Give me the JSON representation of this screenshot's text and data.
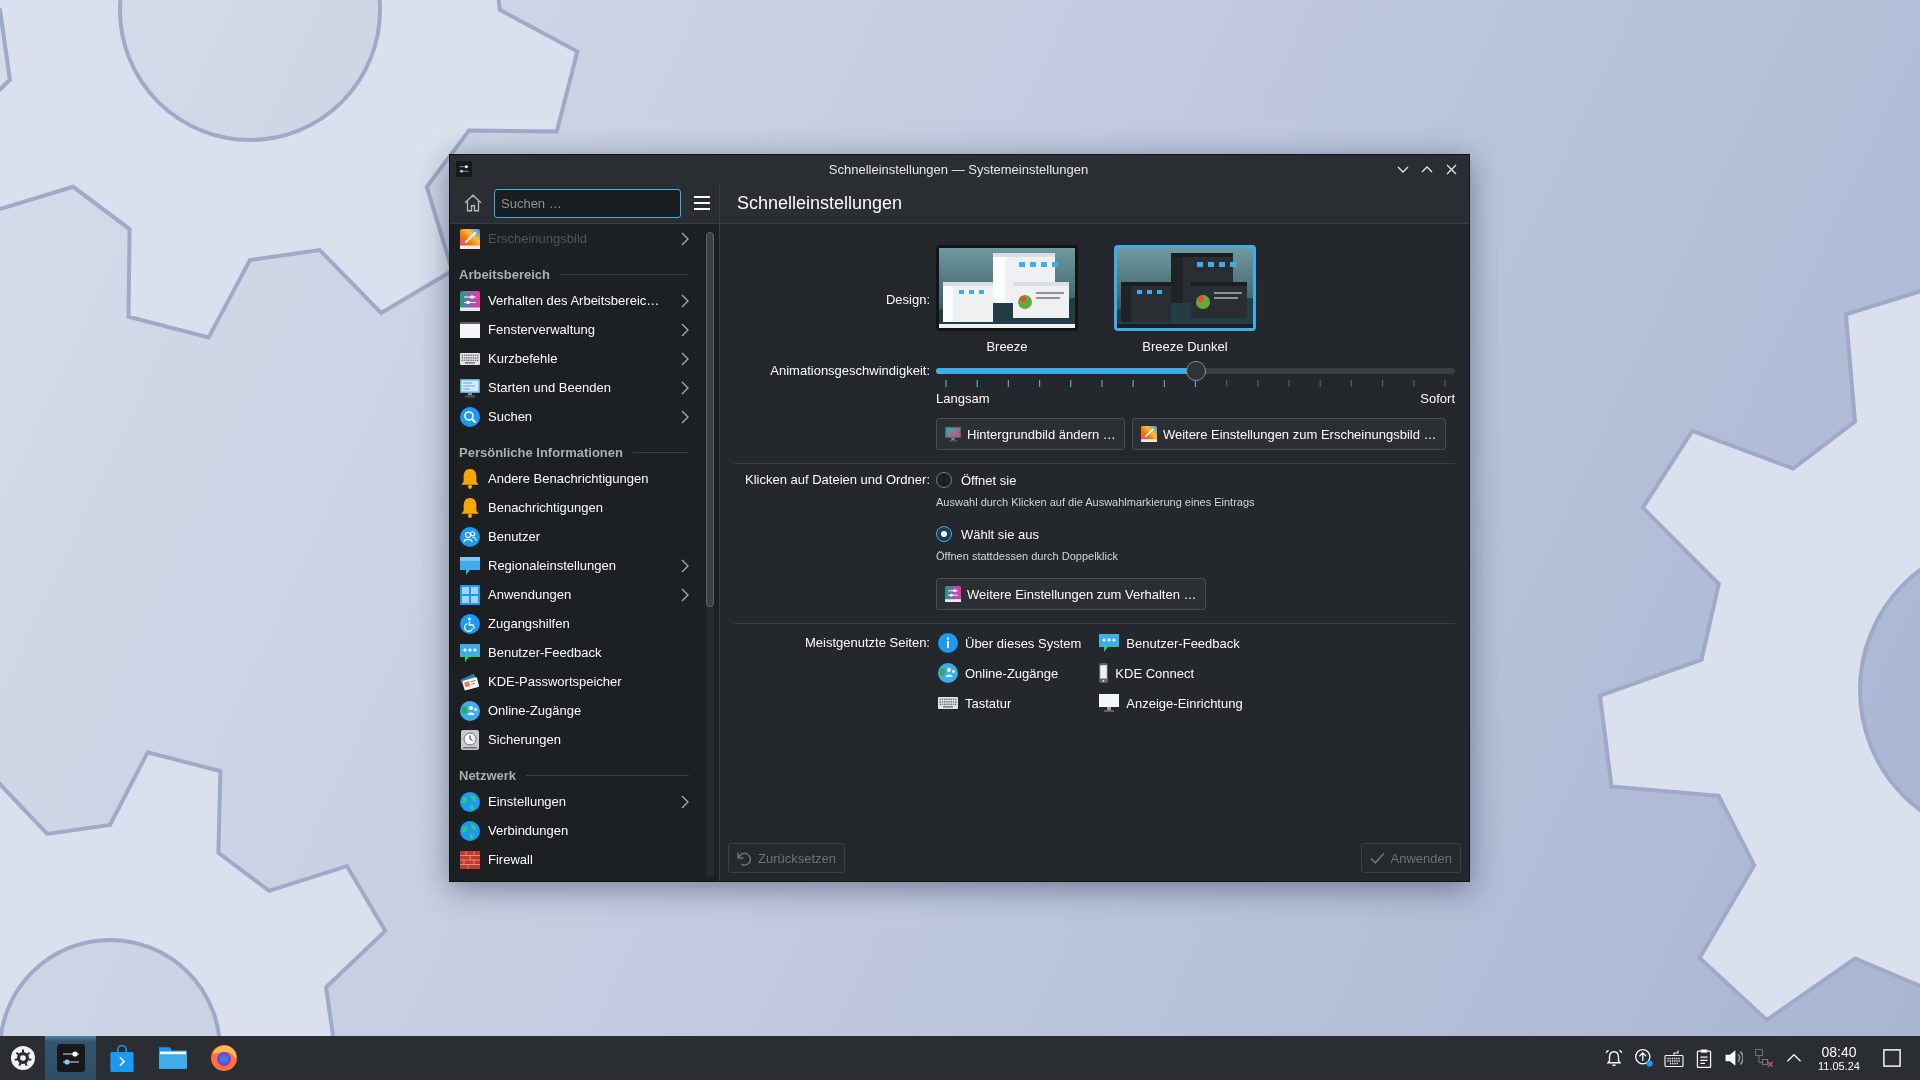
{
  "window": {
    "title": "Schnelleinstellungen — Systemeinstellungen"
  },
  "sidebar": {
    "search": {
      "placeholder": "Suchen …"
    },
    "sections": [
      {
        "items": [
          {
            "label": "Erscheinungsbild",
            "has_subpages": true,
            "dimmed": true,
            "selected": false
          }
        ]
      },
      {
        "heading": "Arbeitsbereich",
        "items": [
          {
            "label": "Verhalten des Arbeitsbereic…",
            "has_subpages": true,
            "dimmed": false,
            "selected": false
          },
          {
            "label": "Fensterverwaltung",
            "has_subpages": true,
            "dimmed": false,
            "selected": false
          },
          {
            "label": "Kurzbefehle",
            "has_subpages": true,
            "dimmed": false,
            "selected": false
          },
          {
            "label": "Starten und Beenden",
            "has_subpages": true,
            "dimmed": false,
            "selected": false
          },
          {
            "label": "Suchen",
            "has_subpages": true,
            "dimmed": false,
            "selected": false
          }
        ]
      },
      {
        "heading": "Persönliche Informationen",
        "items": [
          {
            "label": "Andere Benachrichtigungen",
            "has_subpages": false,
            "dimmed": false,
            "selected": false
          },
          {
            "label": "Benachrichtigungen",
            "has_subpages": false,
            "dimmed": false,
            "selected": false
          },
          {
            "label": "Benutzer",
            "has_subpages": false,
            "dimmed": false,
            "selected": false
          },
          {
            "label": "Regionaleinstellungen",
            "has_subpages": true,
            "dimmed": false,
            "selected": false
          },
          {
            "label": "Anwendungen",
            "has_subpages": true,
            "dimmed": false,
            "selected": false
          },
          {
            "label": "Zugangshilfen",
            "has_subpages": false,
            "dimmed": false,
            "selected": false
          },
          {
            "label": "Benutzer-Feedback",
            "has_subpages": false,
            "dimmed": false,
            "selected": false
          },
          {
            "label": "KDE-Passwortspeicher",
            "has_subpages": false,
            "dimmed": false,
            "selected": false
          },
          {
            "label": "Online-Zugänge",
            "has_subpages": false,
            "dimmed": false,
            "selected": false
          },
          {
            "label": "Sicherungen",
            "has_subpages": false,
            "dimmed": false,
            "selected": false
          }
        ]
      },
      {
        "heading": "Netzwerk",
        "items": [
          {
            "label": "Einstellungen",
            "has_subpages": true,
            "dimmed": false,
            "selected": false
          },
          {
            "label": "Verbindungen",
            "has_subpages": false,
            "dimmed": false,
            "selected": false
          },
          {
            "label": "Firewall",
            "has_subpages": false,
            "dimmed": false,
            "selected": false
          }
        ]
      }
    ]
  },
  "page": {
    "title": "Schnelleinstellungen",
    "design": {
      "label": "Design:",
      "themes": [
        {
          "label": "Breeze",
          "kind": "light",
          "selected": false
        },
        {
          "label": "Breeze Dunkel",
          "kind": "dark",
          "selected": true
        }
      ]
    },
    "animation_speed": {
      "label": "Animationsgeschwindigkeit:",
      "level": 0.5,
      "min_label": "Langsam",
      "max_label": "Sofort"
    },
    "appearance_buttons": [
      "Hintergrundbild ändern …",
      "Weitere Einstellungen zum Erscheinungsbild …"
    ],
    "click_behavior": {
      "label": "Klicken auf Dateien und Ordner:",
      "options": [
        {
          "label": "Öffnet sie",
          "hint": "Auswahl durch Klicken auf die Auswahlmarkierung eines Eintrags",
          "selected": false
        },
        {
          "label": "Wählt sie aus",
          "hint": "Öffnen stattdessen durch Doppelklick",
          "selected": true
        }
      ],
      "button": "Weitere Einstellungen zum Verhalten …"
    },
    "most_used": {
      "label": "Meistgenutzte Seiten:",
      "items": [
        "Über dieses System",
        "Benutzer-Feedback",
        "Online-Zugänge",
        "KDE Connect",
        "Tastatur",
        "Anzeige-Einrichtung"
      ]
    }
  },
  "footer": {
    "buttons": [
      {
        "label": "Zurücksetzen",
        "disabled": true
      },
      {
        "label": "Anwenden",
        "disabled": true
      }
    ]
  },
  "taskbar": {
    "tasks": [
      {
        "selected": true
      },
      {
        "selected": false
      },
      {
        "selected": false
      },
      {
        "selected": false
      }
    ],
    "clock": {
      "time": "08:40",
      "date": "11.05.24"
    }
  }
}
